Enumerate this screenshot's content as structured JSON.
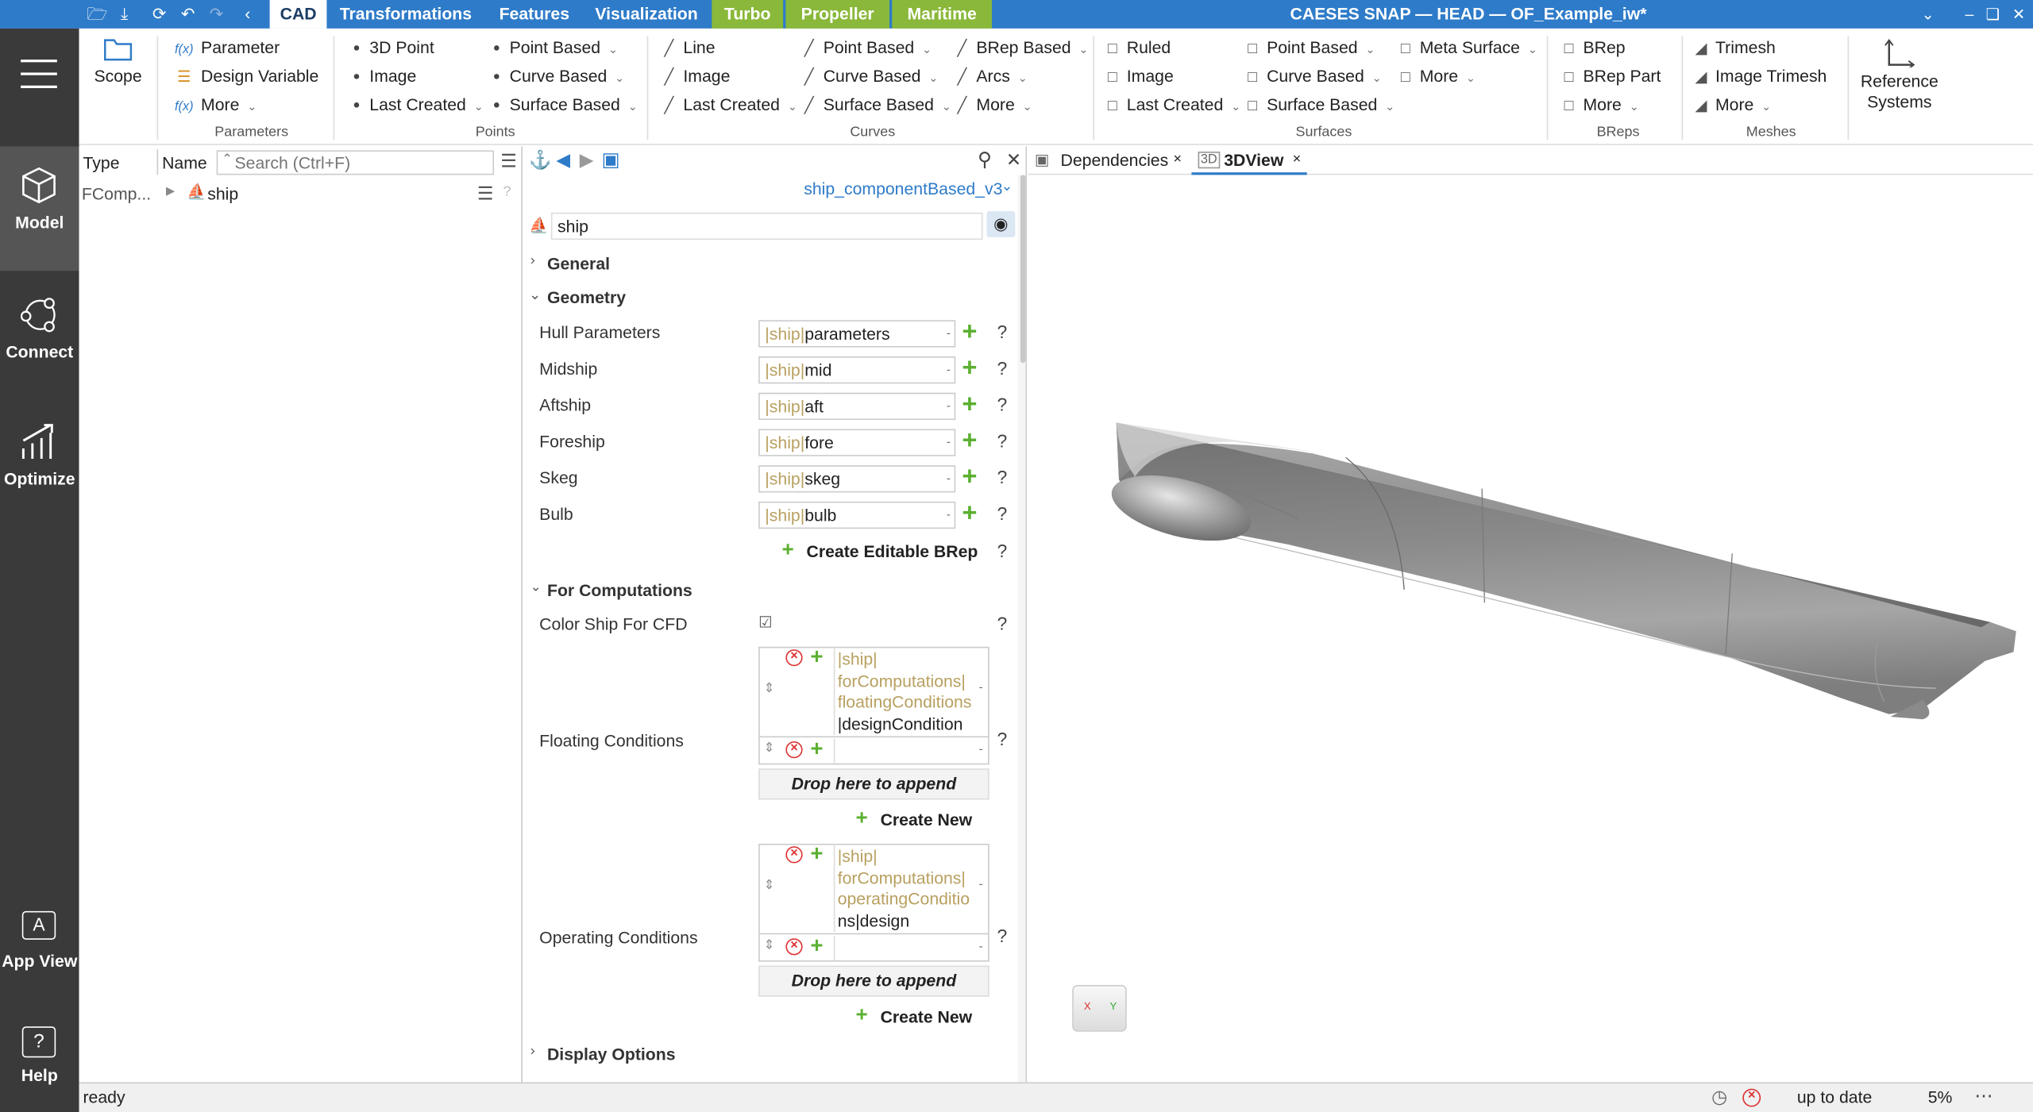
{
  "titlebar": {
    "window_title": "CAESES SNAP — HEAD — OF_Example_iw*",
    "tabs": [
      "CAD",
      "Transformations",
      "Features",
      "Visualization",
      "Turbo",
      "Propeller",
      "Maritime"
    ]
  },
  "nav": {
    "model": "Model",
    "connect": "Connect",
    "optimize": "Optimize",
    "app_view": "App View",
    "help": "Help"
  },
  "ribbon": {
    "scope": "Scope",
    "parameters": {
      "parameter": "Parameter",
      "design_variable": "Design Variable",
      "more": "More",
      "group": "Parameters"
    },
    "points": {
      "p3d": "3D Point",
      "image": "Image",
      "last_created": "Last Created",
      "point_based": "Point Based",
      "curve_based": "Curve Based",
      "surface_based": "Surface Based",
      "group": "Points"
    },
    "curves": {
      "line": "Line",
      "image": "Image",
      "last_created": "Last Created",
      "point_based": "Point Based",
      "curve_based": "Curve Based",
      "surface_based": "Surface Based",
      "brep_based": "BRep Based",
      "arcs": "Arcs",
      "more": "More",
      "group": "Curves"
    },
    "surfaces": {
      "ruled": "Ruled",
      "image": "Image",
      "last_created": "Last Created",
      "point_based": "Point Based",
      "curve_based": "Curve Based",
      "surface_based": "Surface Based",
      "meta_surface": "Meta Surface",
      "more": "More",
      "group": "Surfaces"
    },
    "breps": {
      "brep": "BRep",
      "brep_part": "BRep Part",
      "more": "More",
      "group": "BReps"
    },
    "meshes": {
      "trimesh": "Trimesh",
      "image_trimesh": "Image Trimesh",
      "more": "More",
      "group": "Meshes"
    },
    "reference_line1": "Reference",
    "reference_line2": "Systems"
  },
  "tree": {
    "col_type": "Type",
    "col_name": "Name",
    "search_placeholder": "Search (Ctrl+F)",
    "row_type": "FComp...",
    "row_name": "ship"
  },
  "props": {
    "type_selector": "ship_componentBased_v3",
    "object_name": "ship",
    "sections": {
      "general": "General",
      "geometry": "Geometry",
      "for_computations": "For Computations",
      "display_options": "Display Options"
    },
    "geometry_rows": [
      {
        "label": "Hull Parameters",
        "prefix": "|ship|",
        "value": "parameters"
      },
      {
        "label": "Midship",
        "prefix": "|ship|",
        "value": "mid"
      },
      {
        "label": "Aftship",
        "prefix": "|ship|",
        "value": "aft"
      },
      {
        "label": "Foreship",
        "prefix": "|ship|",
        "value": "fore"
      },
      {
        "label": "Skeg",
        "prefix": "|ship|",
        "value": "skeg"
      },
      {
        "label": "Bulb",
        "prefix": "|ship|",
        "value": "bulb"
      }
    ],
    "create_editable_brep": "Create Editable BRep",
    "color_ship_label": "Color Ship For CFD",
    "floating_label": "Floating Conditions",
    "floating_lines": [
      "|ship|",
      "forComputations|",
      "floatingConditions",
      "|designCondition"
    ],
    "operating_label": "Operating Conditions",
    "operating_lines": [
      "|ship|",
      "forComputations|",
      "operatingConditio",
      "ns|design"
    ],
    "drop_here": "Drop here to append",
    "create_new": "Create New"
  },
  "view": {
    "tab_dependencies": "Dependencies",
    "tab_3dview": "3DView",
    "cube_x": "X",
    "cube_y": "Y"
  },
  "status": {
    "left": "ready",
    "state": "up to date",
    "percent": "5%"
  }
}
